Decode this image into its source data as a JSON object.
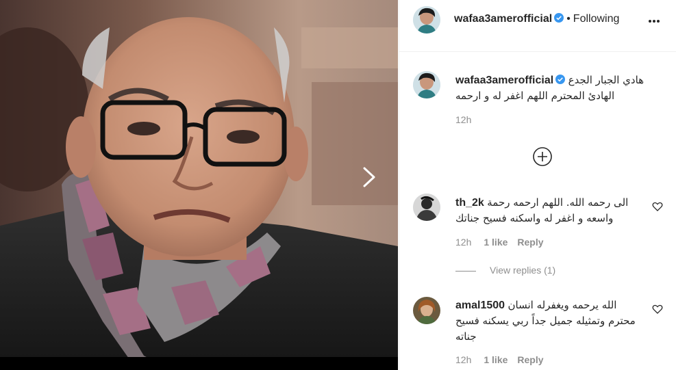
{
  "post": {
    "author": "wafaa3amerofficial",
    "follow_status": "Following",
    "separator": "•",
    "caption_line1": "هادي الجبار الجدع",
    "caption_line2": "الهادئ المحترم اللهم اغفر له و ارحمه",
    "caption_time": "12h"
  },
  "comments": [
    {
      "username": "th_2k",
      "text_line1": "الى رحمه الله. اللهم ارحمه رحمة",
      "text_line2": "واسعه و اغفر له واسكنه فسيح جناتك",
      "time": "12h",
      "likes": "1 like",
      "reply": "Reply",
      "view_replies": "View replies (1)"
    },
    {
      "username": "amal1500",
      "text_line1": "الله يرحمه ويغفرله انسان",
      "text_line2": "محترم وتمثيله جميل جداً ربي يسكنه فسيح",
      "text_line3": "جناته",
      "time": "12h",
      "likes": "1 like",
      "reply": "Reply"
    }
  ],
  "icons": {
    "verified": "verified-badge-icon",
    "more": "more-options-icon",
    "load_more": "plus-circle-icon",
    "heart": "heart-outline-icon",
    "next": "chevron-right-icon"
  },
  "colors": {
    "verified": "#3897f0",
    "text": "#262626",
    "secondary": "#8e8e8e",
    "border": "#efefef"
  }
}
